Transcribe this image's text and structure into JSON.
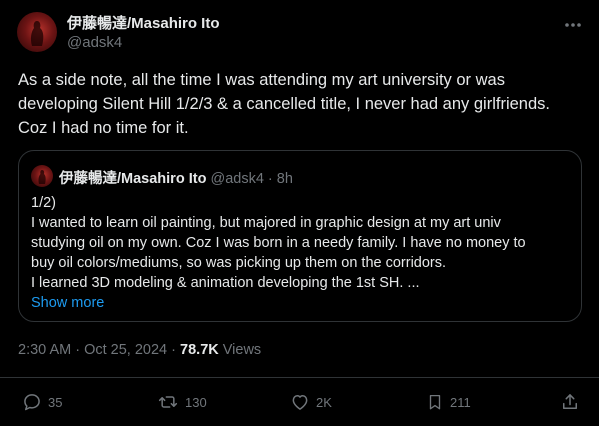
{
  "author": {
    "name": "伊藤暢達/Masahiro Ito",
    "handle": "@adsk4"
  },
  "tweet": {
    "lines": [
      "As a side note, all the time I was attending my art university or was",
      "developing Silent Hill 1/2/3 & a cancelled title, I never had any girlfriends.",
      "Coz I had no time for it."
    ]
  },
  "quote": {
    "name": "伊藤暢達/Masahiro Ito",
    "handle": "@adsk4",
    "separator": "·",
    "time": "8h",
    "lines": [
      "1/2)",
      "I wanted to learn oil painting, but majored in graphic design at my art univ",
      "studying oil on my own. Coz I was born in a needy family. I have no money to",
      "buy oil colors/mediums, so was picking up them on the corridors.",
      "I learned 3D modeling & animation developing the 1st SH. ..."
    ],
    "show_more": "Show more"
  },
  "meta": {
    "timestamp": "2:30 AM · Oct 25, 2024",
    "separator": "·",
    "views_count": "78.7K",
    "views_label": "Views"
  },
  "actions": {
    "replies": "35",
    "reposts": "130",
    "likes": "2K",
    "bookmarks": "211"
  },
  "colors": {
    "background": "#000000",
    "text": "#e7e9ea",
    "secondary": "#71767b",
    "link": "#1d9bf0",
    "border": "#2f3336"
  }
}
